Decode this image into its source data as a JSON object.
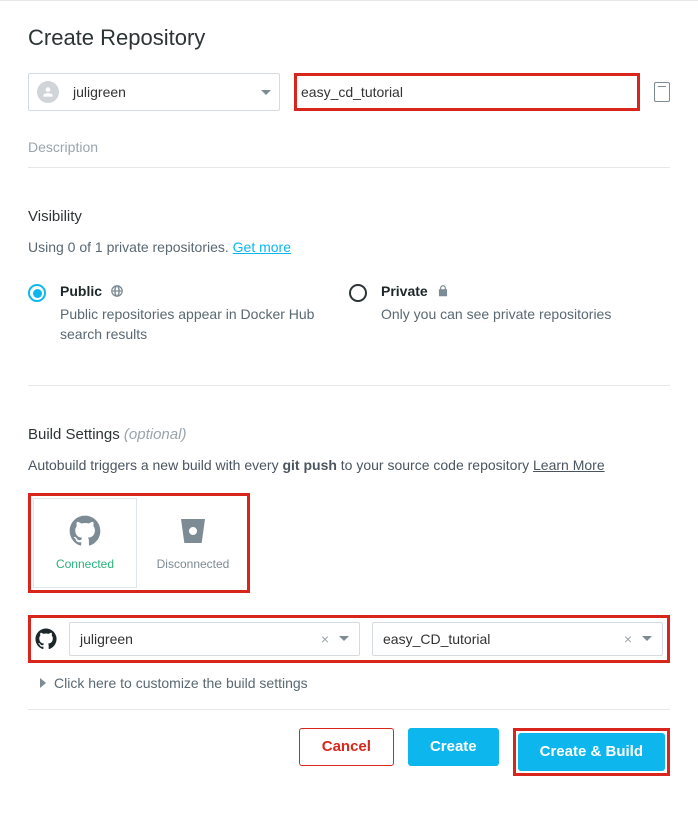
{
  "title": "Create Repository",
  "namespace": {
    "selected": "juligreen"
  },
  "repo_name": {
    "value": "easy_cd_tutorial"
  },
  "description_placeholder": "Description",
  "visibility": {
    "heading": "Visibility",
    "usage_prefix": "Using 0 of 1 private repositories. ",
    "get_more": "Get more",
    "public": {
      "label": "Public",
      "desc": "Public repositories appear in Docker Hub search results",
      "selected": true
    },
    "private": {
      "label": "Private",
      "desc": "Only you can see private repositories",
      "selected": false
    }
  },
  "build": {
    "heading": "Build Settings",
    "optional": "(optional)",
    "desc_pre": "Autobuild triggers a new build with every ",
    "desc_bold": "git push",
    "desc_post": " to your source code repository ",
    "learn_more": "Learn More",
    "providers": {
      "github": {
        "label": "Connected",
        "icon": "github"
      },
      "bitbucket": {
        "label": "Disconnected",
        "icon": "bitbucket"
      }
    },
    "source_org": "juligreen",
    "source_repo": "easy_CD_tutorial",
    "customize": "Click here to customize the build settings"
  },
  "actions": {
    "cancel": "Cancel",
    "create": "Create",
    "create_build": "Create & Build"
  }
}
